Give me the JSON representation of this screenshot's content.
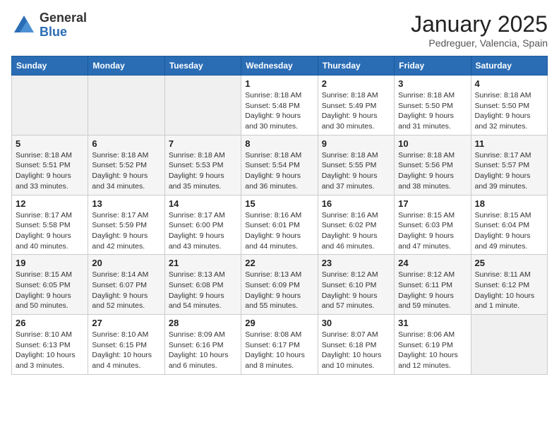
{
  "header": {
    "logo_general": "General",
    "logo_blue": "Blue",
    "month": "January 2025",
    "location": "Pedreguer, Valencia, Spain"
  },
  "days_of_week": [
    "Sunday",
    "Monday",
    "Tuesday",
    "Wednesday",
    "Thursday",
    "Friday",
    "Saturday"
  ],
  "weeks": [
    [
      {
        "day": "",
        "info": ""
      },
      {
        "day": "",
        "info": ""
      },
      {
        "day": "",
        "info": ""
      },
      {
        "day": "1",
        "info": "Sunrise: 8:18 AM\nSunset: 5:48 PM\nDaylight: 9 hours\nand 30 minutes."
      },
      {
        "day": "2",
        "info": "Sunrise: 8:18 AM\nSunset: 5:49 PM\nDaylight: 9 hours\nand 30 minutes."
      },
      {
        "day": "3",
        "info": "Sunrise: 8:18 AM\nSunset: 5:50 PM\nDaylight: 9 hours\nand 31 minutes."
      },
      {
        "day": "4",
        "info": "Sunrise: 8:18 AM\nSunset: 5:50 PM\nDaylight: 9 hours\nand 32 minutes."
      }
    ],
    [
      {
        "day": "5",
        "info": "Sunrise: 8:18 AM\nSunset: 5:51 PM\nDaylight: 9 hours\nand 33 minutes."
      },
      {
        "day": "6",
        "info": "Sunrise: 8:18 AM\nSunset: 5:52 PM\nDaylight: 9 hours\nand 34 minutes."
      },
      {
        "day": "7",
        "info": "Sunrise: 8:18 AM\nSunset: 5:53 PM\nDaylight: 9 hours\nand 35 minutes."
      },
      {
        "day": "8",
        "info": "Sunrise: 8:18 AM\nSunset: 5:54 PM\nDaylight: 9 hours\nand 36 minutes."
      },
      {
        "day": "9",
        "info": "Sunrise: 8:18 AM\nSunset: 5:55 PM\nDaylight: 9 hours\nand 37 minutes."
      },
      {
        "day": "10",
        "info": "Sunrise: 8:18 AM\nSunset: 5:56 PM\nDaylight: 9 hours\nand 38 minutes."
      },
      {
        "day": "11",
        "info": "Sunrise: 8:17 AM\nSunset: 5:57 PM\nDaylight: 9 hours\nand 39 minutes."
      }
    ],
    [
      {
        "day": "12",
        "info": "Sunrise: 8:17 AM\nSunset: 5:58 PM\nDaylight: 9 hours\nand 40 minutes."
      },
      {
        "day": "13",
        "info": "Sunrise: 8:17 AM\nSunset: 5:59 PM\nDaylight: 9 hours\nand 42 minutes."
      },
      {
        "day": "14",
        "info": "Sunrise: 8:17 AM\nSunset: 6:00 PM\nDaylight: 9 hours\nand 43 minutes."
      },
      {
        "day": "15",
        "info": "Sunrise: 8:16 AM\nSunset: 6:01 PM\nDaylight: 9 hours\nand 44 minutes."
      },
      {
        "day": "16",
        "info": "Sunrise: 8:16 AM\nSunset: 6:02 PM\nDaylight: 9 hours\nand 46 minutes."
      },
      {
        "day": "17",
        "info": "Sunrise: 8:15 AM\nSunset: 6:03 PM\nDaylight: 9 hours\nand 47 minutes."
      },
      {
        "day": "18",
        "info": "Sunrise: 8:15 AM\nSunset: 6:04 PM\nDaylight: 9 hours\nand 49 minutes."
      }
    ],
    [
      {
        "day": "19",
        "info": "Sunrise: 8:15 AM\nSunset: 6:05 PM\nDaylight: 9 hours\nand 50 minutes."
      },
      {
        "day": "20",
        "info": "Sunrise: 8:14 AM\nSunset: 6:07 PM\nDaylight: 9 hours\nand 52 minutes."
      },
      {
        "day": "21",
        "info": "Sunrise: 8:13 AM\nSunset: 6:08 PM\nDaylight: 9 hours\nand 54 minutes."
      },
      {
        "day": "22",
        "info": "Sunrise: 8:13 AM\nSunset: 6:09 PM\nDaylight: 9 hours\nand 55 minutes."
      },
      {
        "day": "23",
        "info": "Sunrise: 8:12 AM\nSunset: 6:10 PM\nDaylight: 9 hours\nand 57 minutes."
      },
      {
        "day": "24",
        "info": "Sunrise: 8:12 AM\nSunset: 6:11 PM\nDaylight: 9 hours\nand 59 minutes."
      },
      {
        "day": "25",
        "info": "Sunrise: 8:11 AM\nSunset: 6:12 PM\nDaylight: 10 hours\nand 1 minute."
      }
    ],
    [
      {
        "day": "26",
        "info": "Sunrise: 8:10 AM\nSunset: 6:13 PM\nDaylight: 10 hours\nand 3 minutes."
      },
      {
        "day": "27",
        "info": "Sunrise: 8:10 AM\nSunset: 6:15 PM\nDaylight: 10 hours\nand 4 minutes."
      },
      {
        "day": "28",
        "info": "Sunrise: 8:09 AM\nSunset: 6:16 PM\nDaylight: 10 hours\nand 6 minutes."
      },
      {
        "day": "29",
        "info": "Sunrise: 8:08 AM\nSunset: 6:17 PM\nDaylight: 10 hours\nand 8 minutes."
      },
      {
        "day": "30",
        "info": "Sunrise: 8:07 AM\nSunset: 6:18 PM\nDaylight: 10 hours\nand 10 minutes."
      },
      {
        "day": "31",
        "info": "Sunrise: 8:06 AM\nSunset: 6:19 PM\nDaylight: 10 hours\nand 12 minutes."
      },
      {
        "day": "",
        "info": ""
      }
    ]
  ]
}
